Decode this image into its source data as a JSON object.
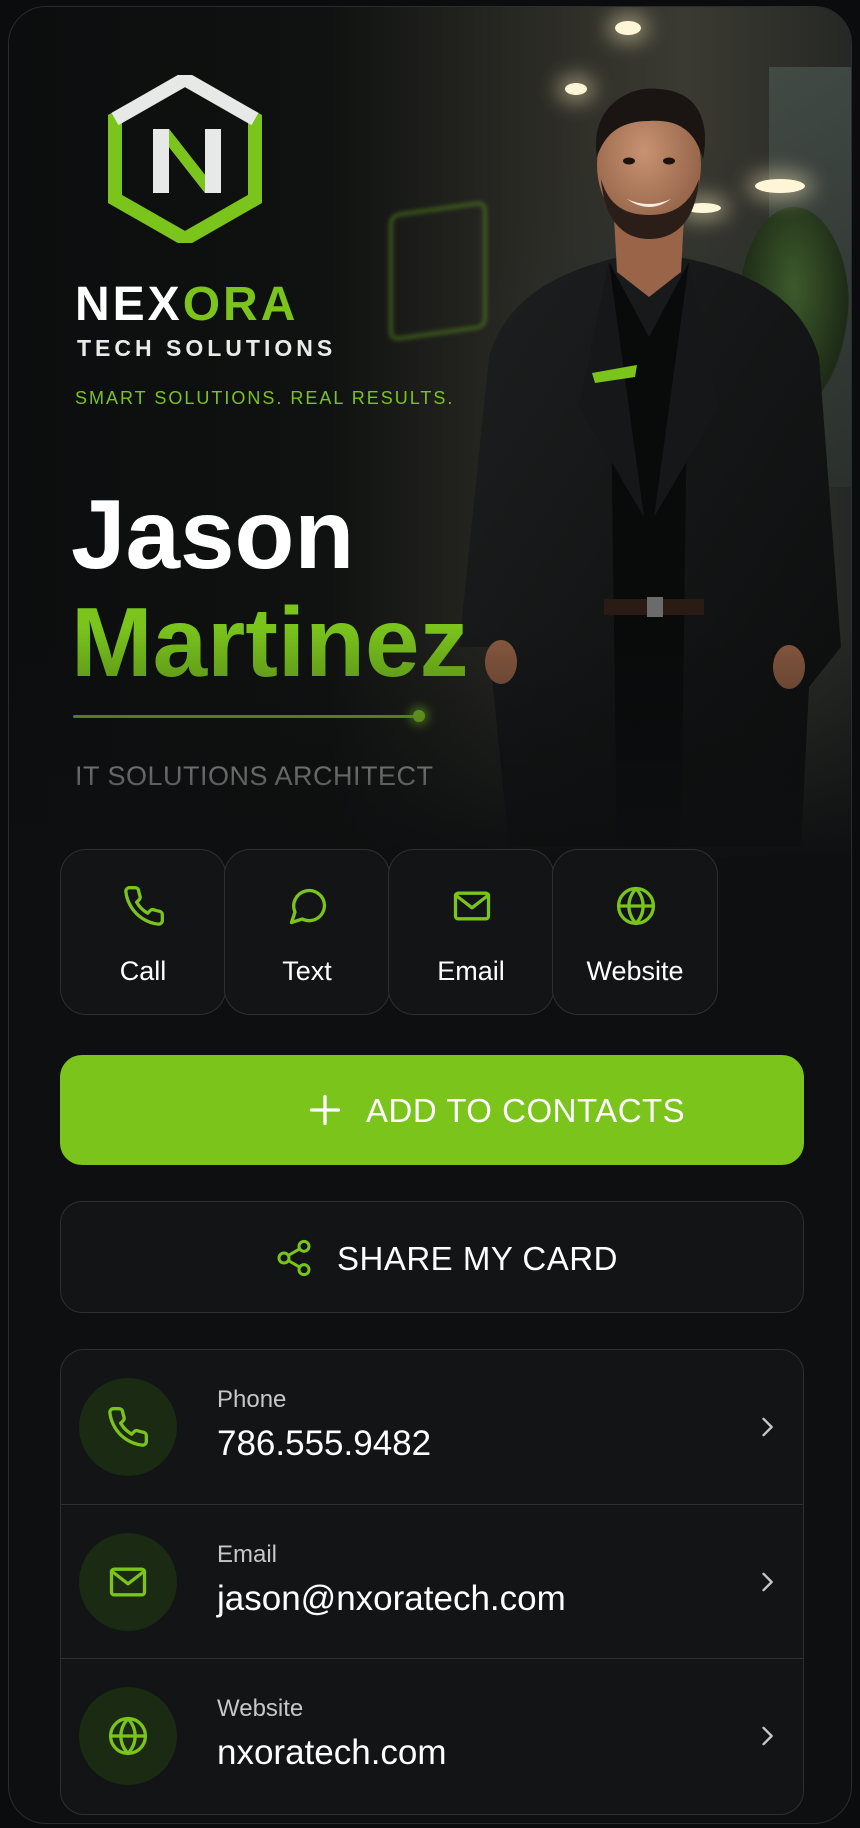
{
  "brand": {
    "name_part1": "NEX",
    "name_part2": "ORA",
    "subtitle": "TECH SOLUTIONS",
    "tagline": "SMART SOLUTIONS. REAL RESULTS.",
    "logo_icon": "hexagon-n-logo"
  },
  "profile": {
    "first_name": "Jason",
    "last_name": "Martinez",
    "role": "IT SOLUTIONS ARCHITECT",
    "photo": "portrait-photo"
  },
  "quick_actions": [
    {
      "label": "Call",
      "icon": "phone-icon"
    },
    {
      "label": "Text",
      "icon": "chat-bubble-icon"
    },
    {
      "label": "Email",
      "icon": "envelope-icon"
    },
    {
      "label": "Website",
      "icon": "globe-icon"
    }
  ],
  "buttons": {
    "add_contacts": "ADD TO CONTACTS",
    "share_card": "SHARE MY CARD"
  },
  "contacts": [
    {
      "label": "Phone",
      "value": "786.555.9482",
      "icon": "phone-icon"
    },
    {
      "label": "Email",
      "value": "jason@nxoratech.com",
      "icon": "envelope-icon"
    },
    {
      "label": "Website",
      "value": "nxoratech.com",
      "icon": "globe-icon"
    }
  ],
  "colors": {
    "accent": "#7ac41c",
    "background": "#0d0f10",
    "surface": "#121415"
  }
}
